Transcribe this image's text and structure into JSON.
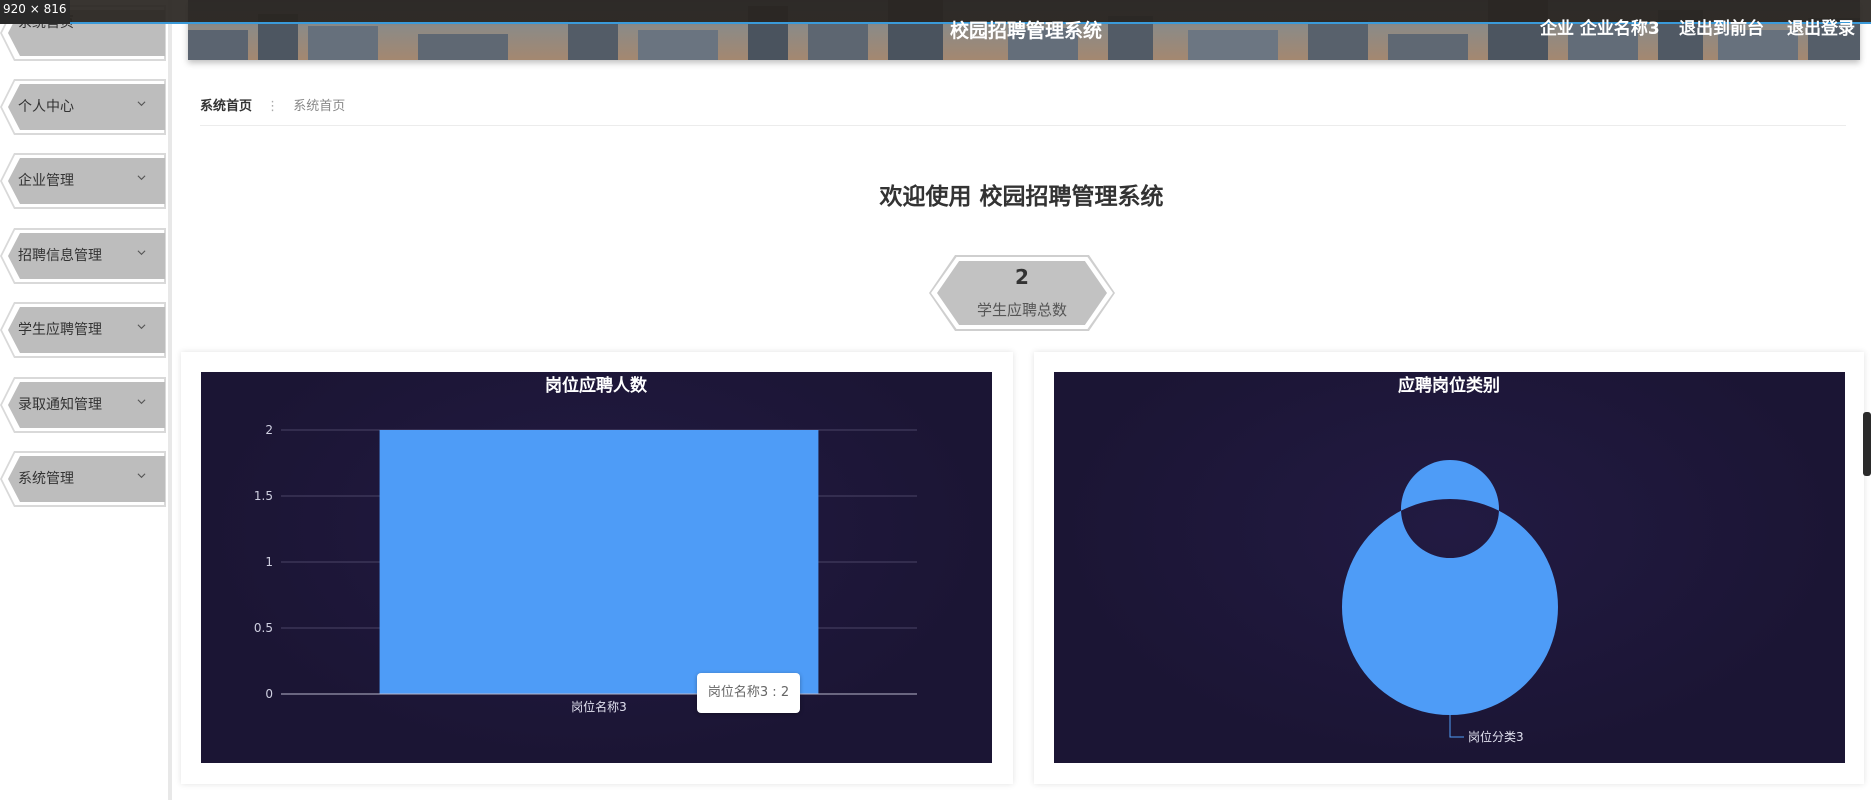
{
  "window": {
    "size_readout": "920 × 816"
  },
  "header": {
    "title": "校园招聘管理系统",
    "user_label": "企业 企业名称3",
    "front_link": "退出到前台",
    "logout": "退出登录"
  },
  "sidebar": {
    "items": [
      {
        "label": "系统首页",
        "has_chevron": false
      },
      {
        "label": "个人中心",
        "has_chevron": true
      },
      {
        "label": "企业管理",
        "has_chevron": true
      },
      {
        "label": "招聘信息管理",
        "has_chevron": true
      },
      {
        "label": "学生应聘管理",
        "has_chevron": true
      },
      {
        "label": "录取通知管理",
        "has_chevron": true
      },
      {
        "label": "系统管理",
        "has_chevron": true
      }
    ]
  },
  "breadcrumb": {
    "home": "系统首页",
    "separator": "⋮",
    "current": "系统首页"
  },
  "welcome": "欢迎使用 校园招聘管理系统",
  "stat": {
    "value": "2",
    "label": "学生应聘总数"
  },
  "chart_data": [
    {
      "type": "bar",
      "title": "岗位应聘人数",
      "categories": [
        "岗位名称3"
      ],
      "values": [
        2
      ],
      "ylim": [
        0,
        2
      ],
      "yticks": [
        "0",
        "0.5",
        "1",
        "1.5",
        "2"
      ],
      "grid": true,
      "bar_color": "#4e9cf7",
      "tooltip": "岗位名称3 : 2"
    },
    {
      "type": "pie",
      "title": "应聘岗位类别",
      "labels": [
        "岗位分类3"
      ],
      "values": [
        1
      ],
      "donut": true,
      "color": "#4e9cf7"
    }
  ],
  "colors": {
    "chart_bg": "#1b1534",
    "accent": "#4e9cf7",
    "menu_bg": "#bdbdbd"
  }
}
